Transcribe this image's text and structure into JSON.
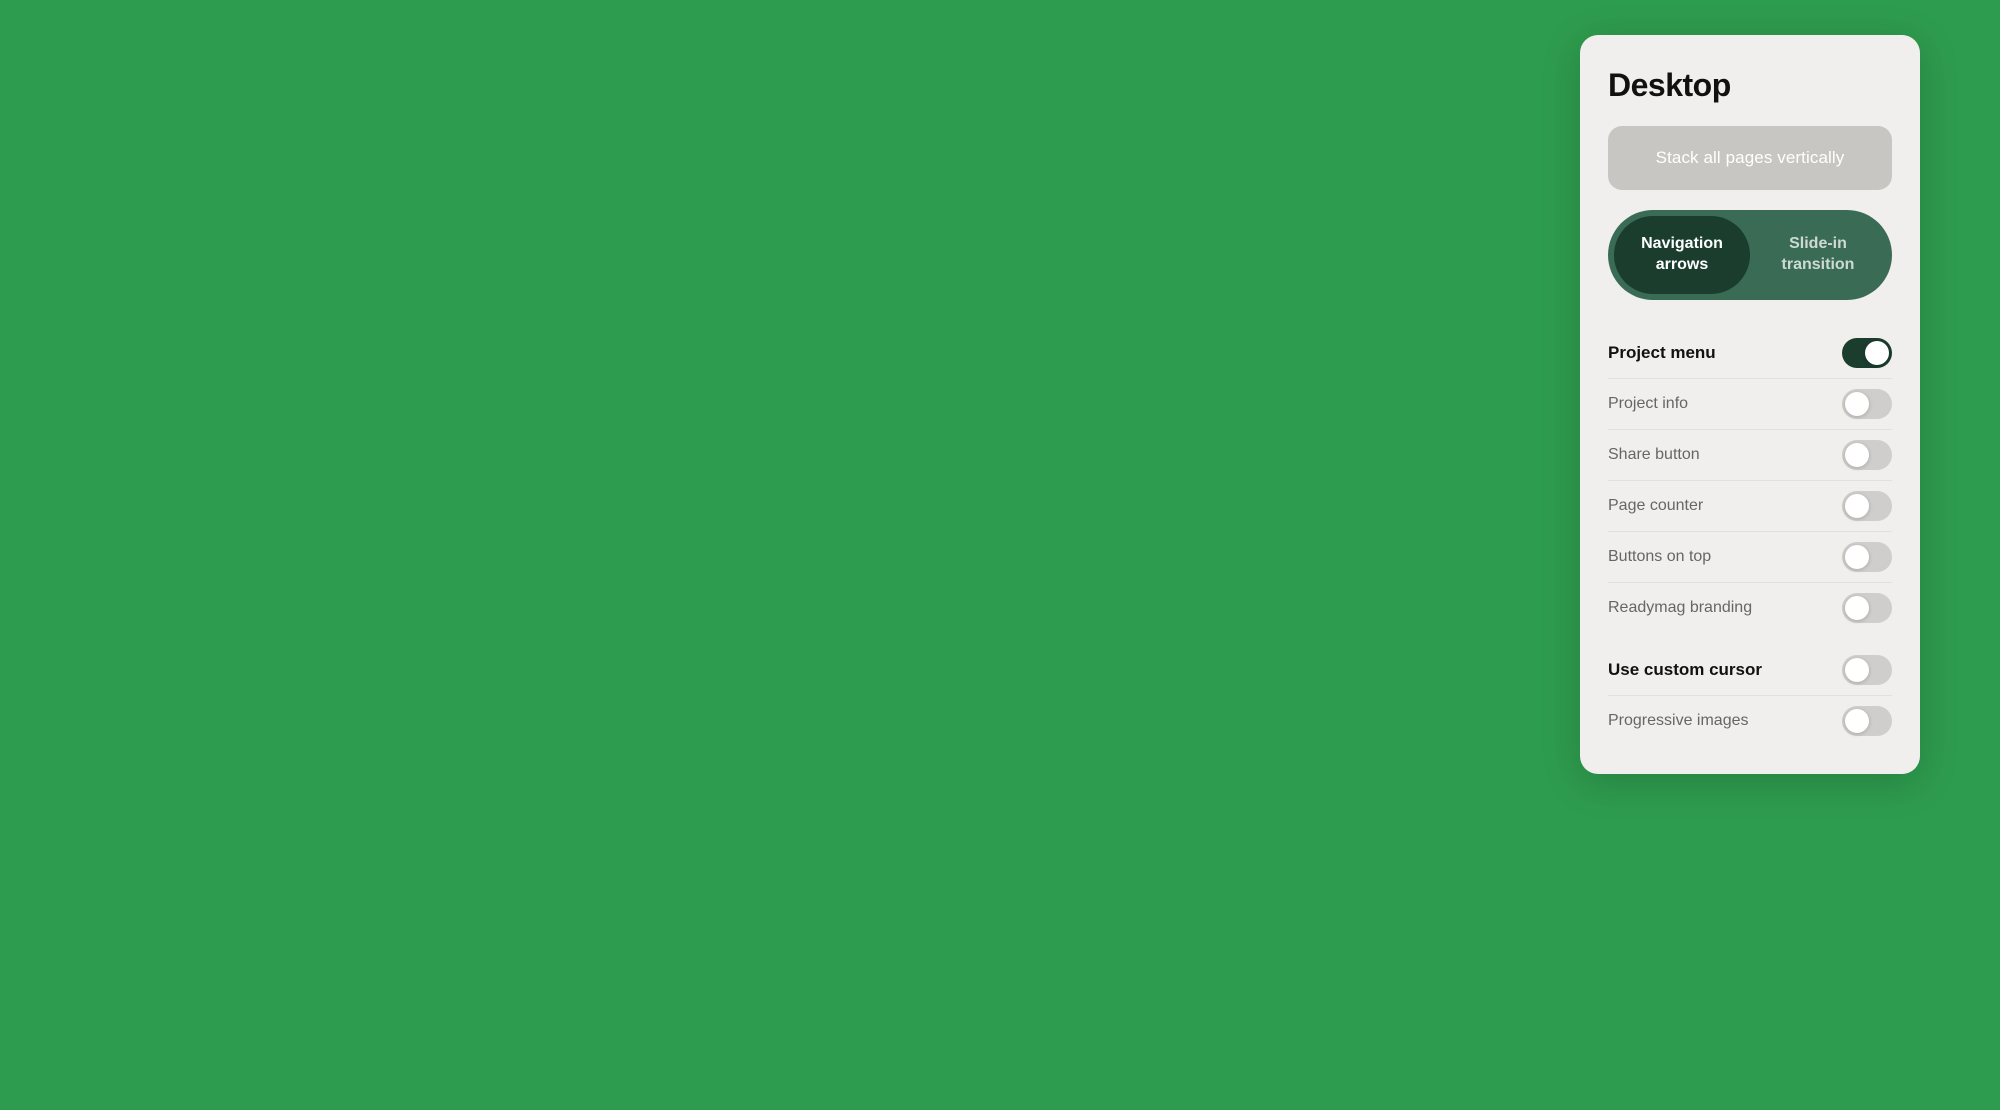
{
  "background_color": "#2e9c4e",
  "panel": {
    "title": "Desktop",
    "stack_button_label": "Stack all pages vertically",
    "toggle_group": {
      "option1": "Navigation\narrows",
      "option2": "Slide-in\ntransition",
      "active_index": 0
    },
    "settings": [
      {
        "label": "Project menu",
        "checked": true,
        "bold": true
      },
      {
        "label": "Project info",
        "checked": false,
        "bold": false
      },
      {
        "label": "Share button",
        "checked": false,
        "bold": false
      },
      {
        "label": "Page counter",
        "checked": false,
        "bold": false
      },
      {
        "label": "Buttons on top",
        "checked": false,
        "bold": false
      },
      {
        "label": "Readymag branding",
        "checked": false,
        "bold": false
      }
    ],
    "settings2": [
      {
        "label": "Use custom cursor",
        "checked": false,
        "bold": true
      },
      {
        "label": "Progressive images",
        "checked": false,
        "bold": false
      }
    ]
  }
}
